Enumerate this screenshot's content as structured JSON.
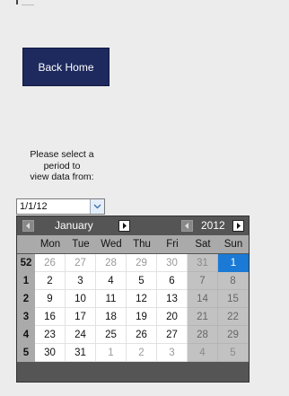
{
  "back_button": {
    "label": "Back Home"
  },
  "prompt": "Please select a\nperiod to\nview data from:",
  "date_input": {
    "value": "1/1/12"
  },
  "calendar": {
    "month": "January",
    "year": "2012",
    "weekdays": [
      "Mon",
      "Tue",
      "Wed",
      "Thu",
      "Fri",
      "Sat",
      "Sun"
    ],
    "weeks": [
      {
        "num": "52",
        "days": [
          "26",
          "27",
          "28",
          "29",
          "30",
          "31",
          "1"
        ]
      },
      {
        "num": "1",
        "days": [
          "2",
          "3",
          "4",
          "5",
          "6",
          "7",
          "8"
        ]
      },
      {
        "num": "2",
        "days": [
          "9",
          "10",
          "11",
          "12",
          "13",
          "14",
          "15"
        ]
      },
      {
        "num": "3",
        "days": [
          "16",
          "17",
          "18",
          "19",
          "20",
          "21",
          "22"
        ]
      },
      {
        "num": "4",
        "days": [
          "23",
          "24",
          "25",
          "26",
          "27",
          "28",
          "29"
        ]
      },
      {
        "num": "5",
        "days": [
          "30",
          "31",
          "1",
          "2",
          "3",
          "4",
          "5"
        ]
      }
    ],
    "selected_day": "1",
    "colors": {
      "header_bg": "#555555",
      "selected": "#1a7ad6",
      "weekend_bg": "#c2c2c2",
      "week_num_bg": "#aaaaaa"
    }
  }
}
